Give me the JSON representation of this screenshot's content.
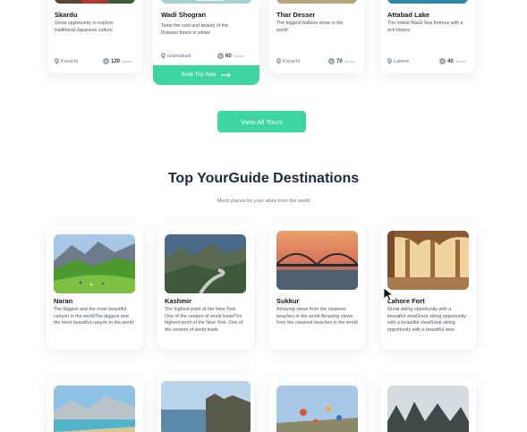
{
  "tours": [
    {
      "name": "Skardu",
      "desc": "Great opportunity to explore traditional Japanese culture",
      "location": "Karachi",
      "price": "120",
      "per": "/person"
    },
    {
      "name": "Wadi Shogran",
      "desc": "Taste the cold and beauty of the Russian forest in winter",
      "location": "Islamabad",
      "price": "60",
      "per": "/person"
    },
    {
      "name": "Thar Desser",
      "desc": "The biggest balloon show in the world",
      "location": "Karachi",
      "price": "70",
      "per": "/person"
    },
    {
      "name": "Attabad Lake",
      "desc": "The oldest Black Sea fortress with a rich history",
      "location": "Lahore",
      "price": "40",
      "per": "/person"
    }
  ],
  "book_button": "Book Trip Now",
  "view_all_button": "View All Tours",
  "destinations_section": {
    "title": "Top YourGuide Destinations",
    "subtitle": "Much places for your vibes from the world"
  },
  "destinations": [
    {
      "name": "Naran",
      "desc": "The biggest and the most beautiful canyon in the worldThe biggest and the most beautiful canyon in the world"
    },
    {
      "name": "Kashmir",
      "desc": "The highest point of the New York. One of the centers of world tradeThe highest point of the New York. One of the centers of world trade"
    },
    {
      "name": "Sukkur",
      "desc": "Amazing views from the cleanest beaches in the world Amazing views from the cleanest beaches in the world"
    },
    {
      "name": "Lahore Fort",
      "desc": "Great skiing opportunity with a beautiful viewGreat skiing opportunity with a beautiful viewGreat skiing opportunity with a beautiful view"
    }
  ],
  "icons": {
    "location": "map-pin-icon",
    "price": "coin-icon",
    "arrow": "arrow-right-icon",
    "cursor": "mouse-pointer-icon"
  },
  "colors": {
    "accent": "#3dd6a3",
    "heading": "#1f2937",
    "text": "#4b5563"
  }
}
